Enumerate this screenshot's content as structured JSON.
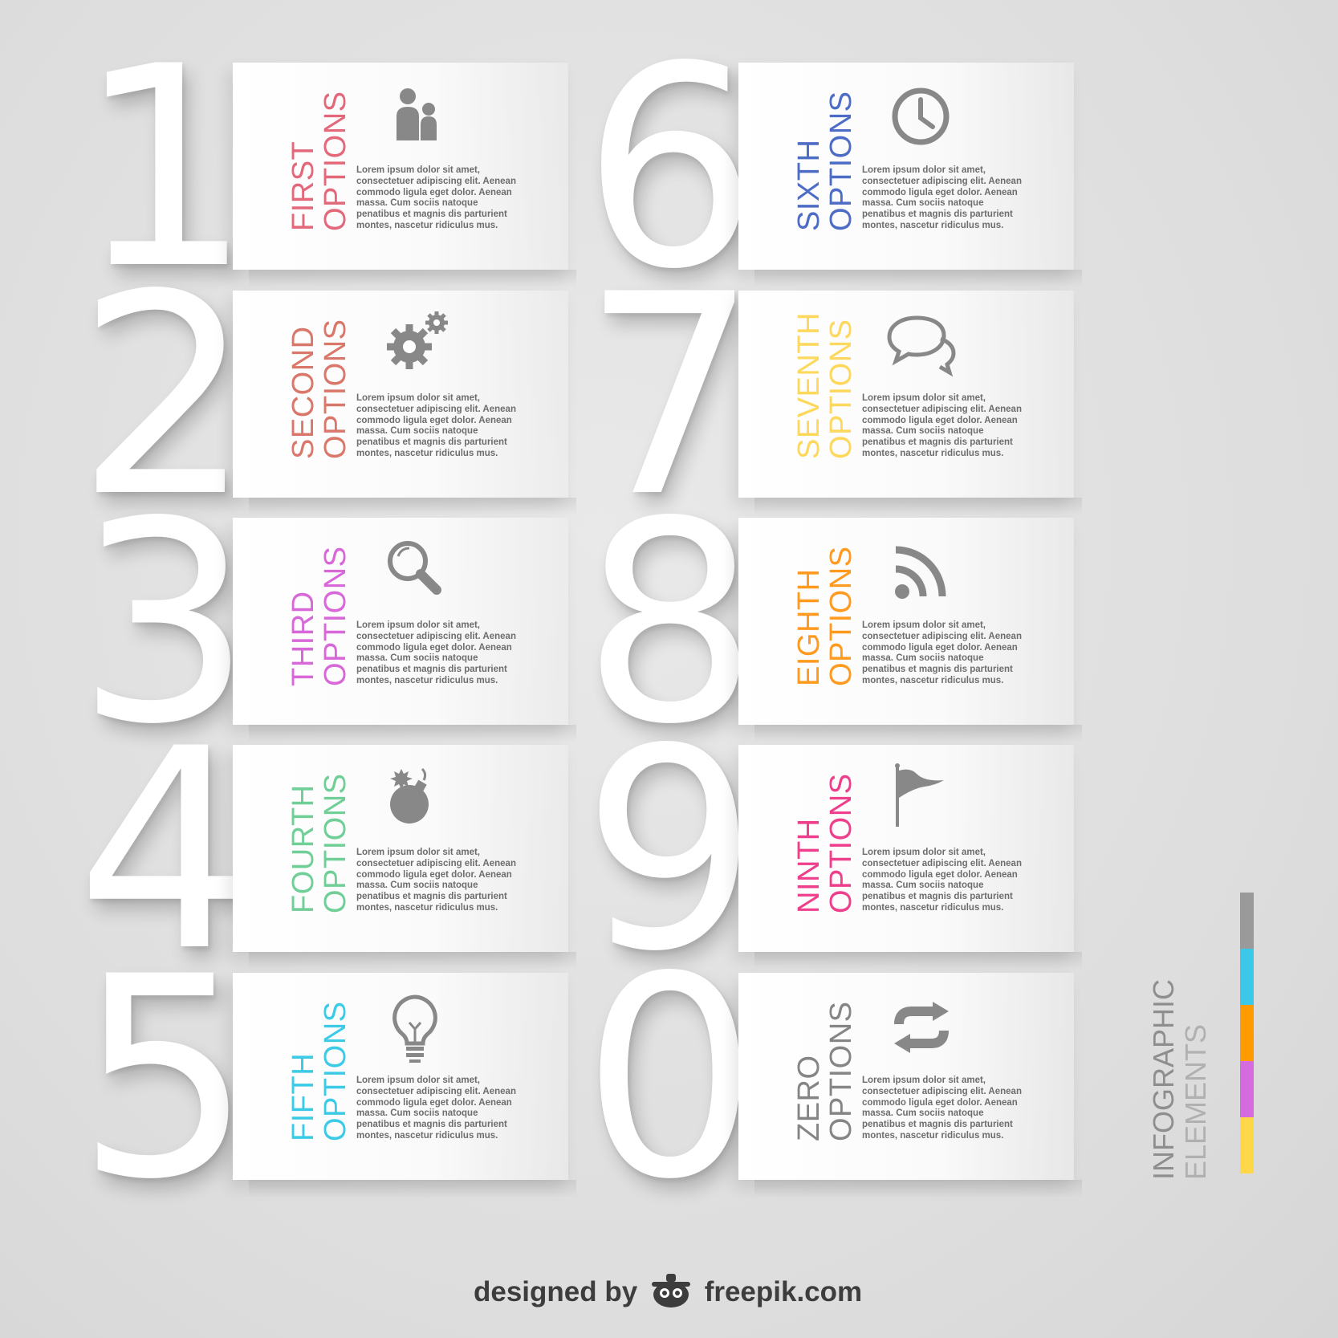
{
  "body_text": "Lorem ipsum dolor sit amet, consectetuer adipiscing elit. Aenean commodo ligula eget dolor. Aenean massa. Cum sociis natoque penatibus et magnis dis parturient montes, nascetur ridiculus mus.",
  "items": [
    {
      "digit": "1",
      "title1": "FIRST",
      "title2": "OPTIONS",
      "color": "#e2687a",
      "icon": "users-icon"
    },
    {
      "digit": "2",
      "title1": "SECOND",
      "title2": "OPTIONS",
      "color": "#d9786a",
      "icon": "gears-icon"
    },
    {
      "digit": "3",
      "title1": "THIRD",
      "title2": "OPTIONS",
      "color": "#d867d8",
      "icon": "search-icon"
    },
    {
      "digit": "4",
      "title1": "FOURTH",
      "title2": "OPTIONS",
      "color": "#6fcf97",
      "icon": "bomb-icon"
    },
    {
      "digit": "5",
      "title1": "FIFTH",
      "title2": "OPTIONS",
      "color": "#3ccbe6",
      "icon": "lightbulb-icon"
    },
    {
      "digit": "6",
      "title1": "SIXTH",
      "title2": "OPTIONS",
      "color": "#4c6cc6",
      "icon": "clock-icon"
    },
    {
      "digit": "7",
      "title1": "SEVENTH",
      "title2": "OPTIONS",
      "color": "#fdd85c",
      "icon": "chat-icon"
    },
    {
      "digit": "8",
      "title1": "EIGHTH",
      "title2": "OPTIONS",
      "color": "#ff9a1f",
      "icon": "rss-icon"
    },
    {
      "digit": "9",
      "title1": "NINTH",
      "title2": "OPTIONS",
      "color": "#ef3f8c",
      "icon": "flag-icon"
    },
    {
      "digit": "0",
      "title1": "ZERO",
      "title2": "OPTIONS",
      "color": "#858585",
      "icon": "refresh-icon"
    }
  ],
  "side_label": {
    "line1": "INFOGRAPHIC",
    "line2": "ELEMENTS"
  },
  "color_bar": [
    "#9a9a9a",
    "#3cc8e8",
    "#ff9a00",
    "#d66be0",
    "#ffd84a"
  ],
  "credit": {
    "prefix": "designed by",
    "brand": "freepik.com"
  }
}
